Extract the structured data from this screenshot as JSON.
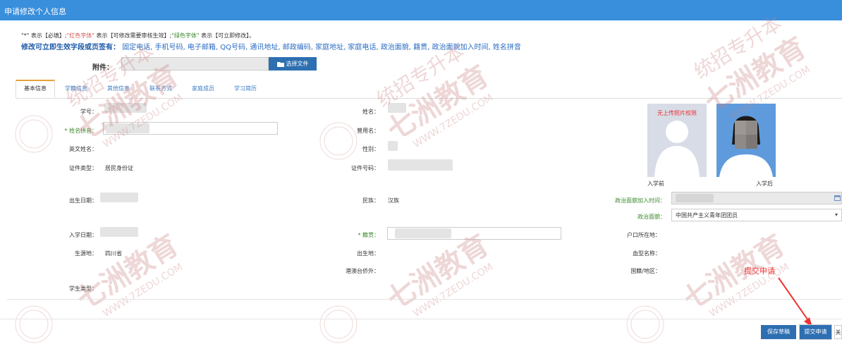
{
  "window": {
    "title": "申请修改个人信息"
  },
  "legend": {
    "part1": "\"*\" 表示【必填】;",
    "red_text": "\"红色字体\"",
    "part2": " 表示【可修改需要审核生效】;",
    "green_text": "\"绿色字体\"",
    "part3": " 表示【可立即修改】。"
  },
  "instant_fields": {
    "label": "修改可立即生效字段或页签有：",
    "fields": "固定电话, 手机号码, 电子邮箱, QQ号码, 通讯地址, 邮政编码, 家庭地址, 家庭电话, 政治面貌, 籍贯, 政治面貌加入时间, 姓名拼音"
  },
  "attachment": {
    "label": "附件：",
    "button_label": "选择文件"
  },
  "tabs": [
    "基本信息",
    "学籍信息",
    "其他信息",
    "联系方式",
    "家庭成员",
    "学习简历"
  ],
  "active_tab": 0,
  "form": {
    "student_no_label": "学号：",
    "name_pinyin_label": "* 姓名拼音：",
    "english_name_label": "英文姓名：",
    "id_type_label": "证件类型：",
    "id_type_value": "居民身份证",
    "birth_date_label": "出生日期：",
    "enroll_date_label": "入学日期：",
    "source_label": "生源地：",
    "source_value": "四川省",
    "student_type_label": "学生类型：",
    "name_label": "姓名：",
    "former_name_label": "曾用名：",
    "gender_label": "性别：",
    "id_no_label": "证件号码：",
    "ethnicity_label": "民族：",
    "ethnicity_value": "汉族",
    "native_place_label": "* 籍贯：",
    "birthplace_label": "出生地：",
    "overseas_label": "港澳台侨外：",
    "political_join_label": "政治面貌加入时间：",
    "political_status_label": "政治面貌：",
    "political_status_value": "中国共产主义青年团团员",
    "hukou_label": "户口所在地：",
    "blood_type_label": "血型名称：",
    "nationality_label": "国籍/地区："
  },
  "photos": {
    "no_permission_text": "无上传照片权限",
    "before_label": "入学前",
    "after_label": "入学后"
  },
  "watermark": {
    "brand": "七洲教育",
    "side": "统招专升本",
    "url": "WWW.7ZEDU.COM"
  },
  "annotation": {
    "callout": "提交申请"
  },
  "buttons": {
    "save_draft": "保存草稿",
    "submit": "提交申请",
    "close": "关"
  },
  "colors": {
    "header": "#3a8fdc",
    "primary_button": "#2d6fb1",
    "red": "#d9534f",
    "green": "#3c8a2e",
    "annotation": "#e33333"
  }
}
